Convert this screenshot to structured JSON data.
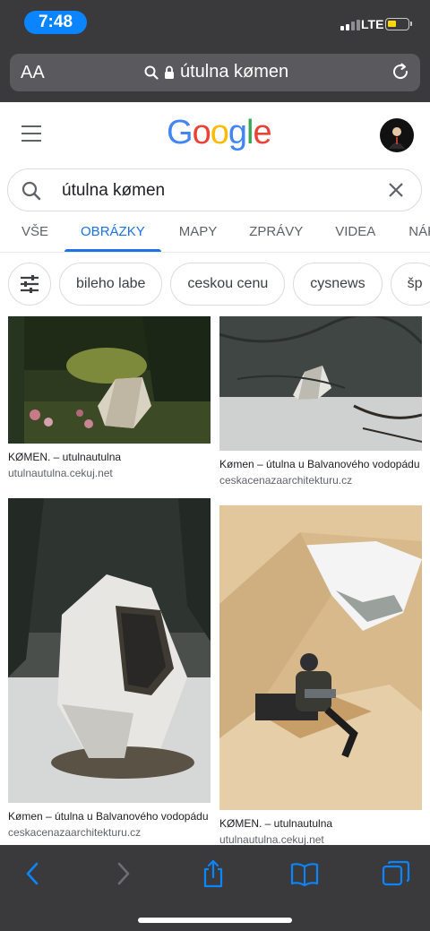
{
  "status": {
    "time": "7:48",
    "network": "LTE"
  },
  "browser": {
    "text_size_label": "AA",
    "url": "útulna kømen"
  },
  "google": {
    "logo": "Google"
  },
  "search": {
    "query": "útulna kømen"
  },
  "tabs": [
    {
      "label": "VŠE"
    },
    {
      "label": "OBRÁZKY"
    },
    {
      "label": "MAPY"
    },
    {
      "label": "ZPRÁVY"
    },
    {
      "label": "VIDEA"
    },
    {
      "label": "NÁKU"
    }
  ],
  "chips": [
    {
      "label": "bileho labe"
    },
    {
      "label": "ceskou cenu"
    },
    {
      "label": "cysnews"
    },
    {
      "label": "šp"
    }
  ],
  "results": [
    {
      "title": "KØMEN. – utulnautulna",
      "source": "utulnautulna.cekuj.net"
    },
    {
      "title": "Kømen – útulna u Balvanového vodopádu",
      "source": "ceskacenazaarchitekturu.cz"
    },
    {
      "title": "Kømen – útulna u Balvanového vodopádu",
      "source": "ceskacenazaarchitekturu.cz"
    },
    {
      "title": "KØMEN. – utulnautulna",
      "source": "utulnautulna.cekuj.net"
    }
  ],
  "colors": {
    "accent": "#1a73e8",
    "chrome": "#3a3a3c",
    "ios_blue": "#0a84ff"
  }
}
